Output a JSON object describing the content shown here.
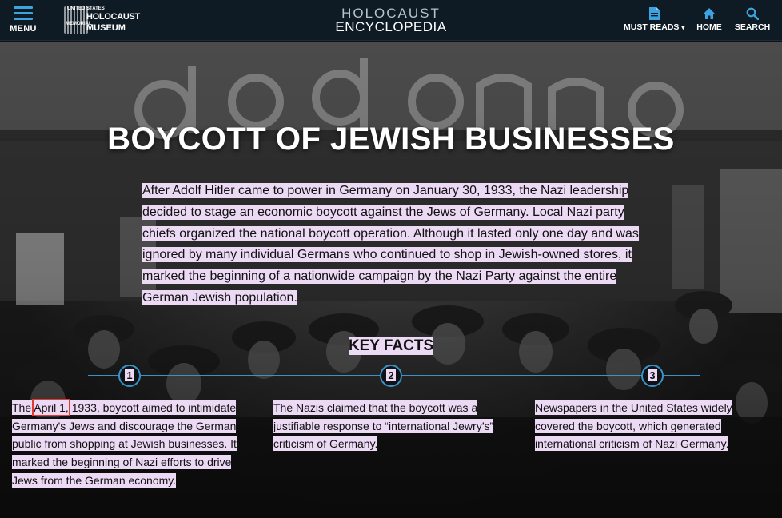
{
  "header": {
    "menu_label": "MENU",
    "logo": {
      "line1": "UNITED STATES",
      "line2": "HOLOCAUST",
      "line3": "MEMORIAL",
      "line4": "MUSEUM"
    },
    "site_title_line1": "HOLOCAUST",
    "site_title_line2": "ENCYCLOPEDIA",
    "nav": {
      "must_reads": "MUST READS",
      "home": "HOME",
      "search": "SEARCH"
    },
    "icons": {
      "menu": "hamburger-icon",
      "must_reads": "document-icon",
      "home": "home-icon",
      "search": "search-icon",
      "dropdown": "chevron-down-icon"
    },
    "accent_color": "#3aa3e0"
  },
  "article": {
    "title": "BOYCOTT OF JEWISH BUSINESSES",
    "intro": "After Adolf Hitler came to power in Germany on January 30, 1933, the Nazi leadership decided to stage an economic boycott against the Jews of Germany. Local Nazi party chiefs organized the national boycott operation. Although it lasted only one day and was ignored by many individual Germans who continued to shop in Jewish-owned stores, it marked the beginning of a nationwide campaign by the Nazi Party against the entire German Jewish population.",
    "key_facts_title": "KEY FACTS",
    "facts": [
      {
        "number": "1",
        "prefix": "The ",
        "highlight": "April 1,",
        "text": " 1933, boycott aimed to intimidate Germany's Jews and discourage the German public from shopping at Jewish businesses. It marked the beginning of Nazi efforts to drive Jews from the German economy."
      },
      {
        "number": "2",
        "text": "The Nazis claimed that the boycott was a justifiable response to “international Jewry’s” criticism of Germany."
      },
      {
        "number": "3",
        "text": "Newspapers in the United States widely covered the boycott, which generated international criticism of Nazi Germany."
      }
    ],
    "text_highlight_color": "#ecd9f3",
    "timeline_color": "#3a93c7",
    "selection_box_color": "#e53935"
  }
}
